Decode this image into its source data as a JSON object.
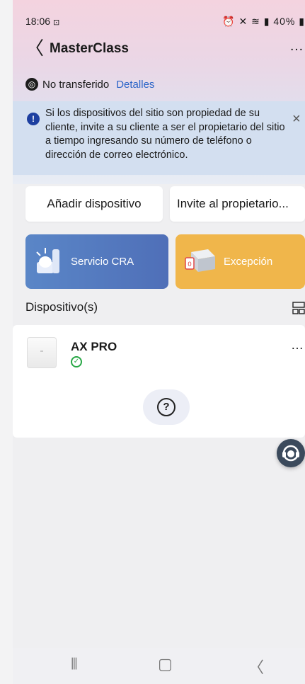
{
  "status_bar": {
    "time": "18:06",
    "time_suffix_icon": "screenshot-icon",
    "right_icons_text": "40%"
  },
  "header": {
    "back_icon": "chevron-left-icon",
    "title": "MasterClass",
    "more_icon": "more-horizontal-icon"
  },
  "transfer": {
    "status_text": "No transferido",
    "details_link": "Detalles"
  },
  "banner": {
    "text": "Si los dispositivos del sitio son propiedad de su cliente, invite a su cliente a ser el propietario del sitio a tiempo ingresando su número de teléfono o dirección de correo electrónico.",
    "close_icon": "close-icon"
  },
  "actions": {
    "add_device": "Añadir dispositivo",
    "invite_owner": "Invite al propietario..."
  },
  "cards": {
    "cra_label": "Servicio CRA",
    "exception_label": "Excepción"
  },
  "devices_section": {
    "title": "Dispositivo(s)"
  },
  "device": {
    "name": "AX PRO"
  },
  "colors": {
    "cra_card": "#5a86c7",
    "exception_card": "#f0b64b",
    "link": "#2b64c8",
    "ok": "#27a745"
  }
}
